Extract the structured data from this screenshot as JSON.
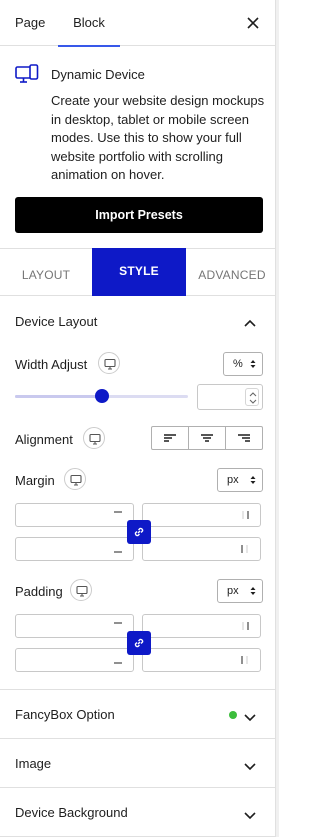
{
  "header": {
    "tab_page": "Page",
    "tab_block": "Block",
    "close_icon": "close-icon"
  },
  "block": {
    "icon": "devices-icon",
    "title": "Dynamic Device",
    "description": "Create your website design mockups in desktop, tablet or mobile screen modes. Use this to show your full website portfolio with scrolling animation on hover.",
    "import_label": "Import Presets"
  },
  "tabs": {
    "layout": "LAYOUT",
    "style": "STYLE",
    "advanced": "ADVANCED",
    "active": "STYLE"
  },
  "device_layout": {
    "title": "Device Layout",
    "width_adjust": {
      "label": "Width Adjust",
      "unit": "%",
      "value": "",
      "slider_fraction": 0.5
    },
    "alignment": {
      "label": "Alignment",
      "options": [
        "left",
        "center",
        "right"
      ]
    },
    "margin": {
      "label": "Margin",
      "unit": "px",
      "top": "",
      "right": "",
      "bottom": "",
      "left": ""
    },
    "padding": {
      "label": "Padding",
      "unit": "px",
      "top": "",
      "right": "",
      "bottom": "",
      "left": ""
    }
  },
  "sections": {
    "fancybox": "FancyBox Option",
    "image": "Image",
    "device_background": "Device Background"
  },
  "colors": {
    "accent": "#0e19c7",
    "status_green": "#3cbd3c",
    "wp_blue": "#3858e9"
  }
}
